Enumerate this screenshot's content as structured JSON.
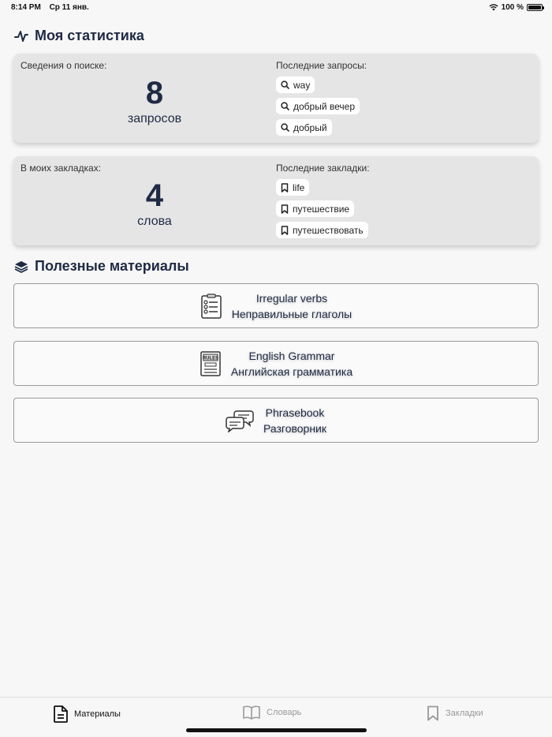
{
  "status_bar": {
    "time": "8:14 PM",
    "date": "Ср 11 янв.",
    "battery": "100 %"
  },
  "stats_section": {
    "title": "Моя статистика"
  },
  "search_card": {
    "label": "Сведения о поиске:",
    "count": "8",
    "unit": "запросов",
    "recent_label": "Последние запросы:",
    "recent": [
      "way",
      "добрый вечер",
      "добрый"
    ]
  },
  "bookmark_card": {
    "label": "В моих закладках:",
    "count": "4",
    "unit": "слова",
    "recent_label": "Последние закладки:",
    "recent": [
      "life",
      "путешествие",
      "путешествовать"
    ]
  },
  "materials_section": {
    "title": "Полезные материалы"
  },
  "materials": [
    {
      "title": "Irregular verbs",
      "subtitle": "Неправильные глаголы",
      "icon": "checklist-icon"
    },
    {
      "title": "English Grammar",
      "subtitle": "Английская грамматика",
      "icon": "rules-book-icon"
    },
    {
      "title": "Phrasebook",
      "subtitle": "Разговорник",
      "icon": "speech-bubbles-icon"
    }
  ],
  "tabs": [
    {
      "label": "Материалы",
      "icon": "document-icon",
      "active": true
    },
    {
      "label": "Словарь",
      "icon": "open-book-icon",
      "active": false
    },
    {
      "label": "Закладки",
      "icon": "bookmark-icon",
      "active": false
    }
  ],
  "colors": {
    "accent": "#1f2a44",
    "card_bg": "#e5e5e5",
    "inactive": "#999999"
  }
}
